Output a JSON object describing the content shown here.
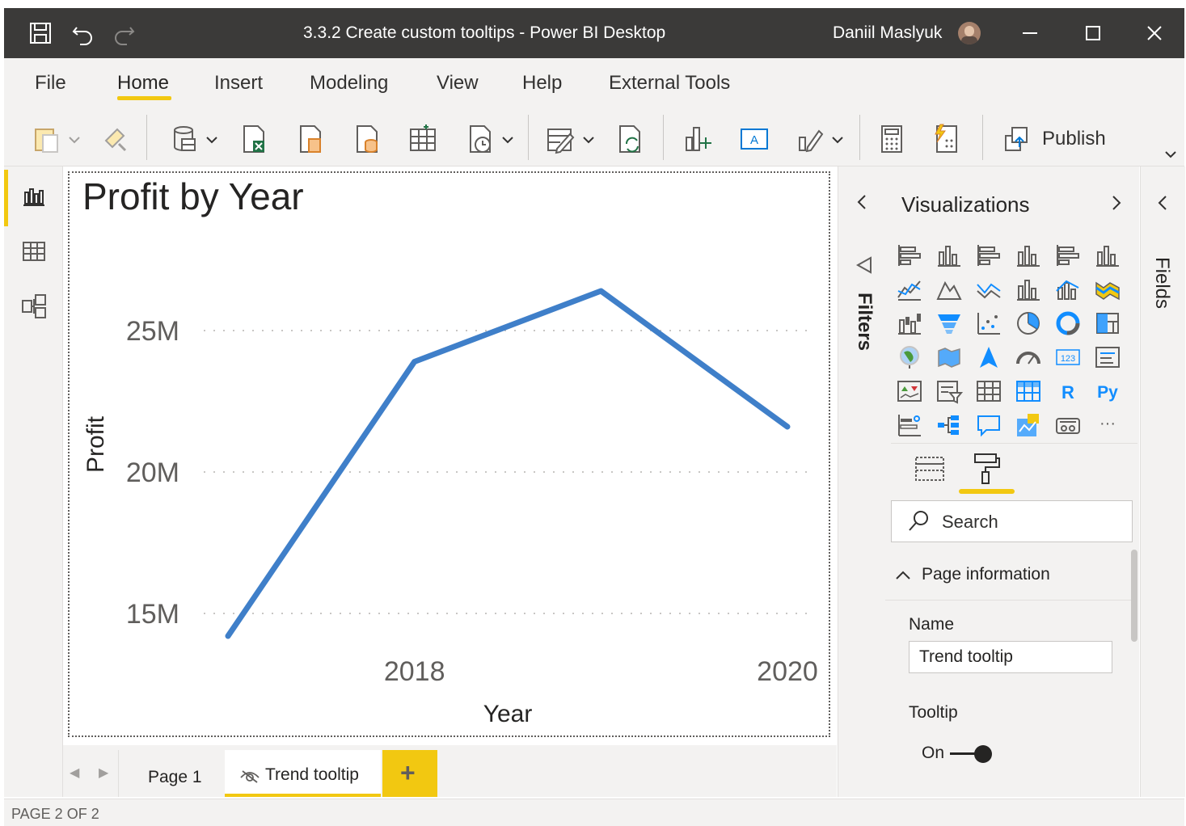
{
  "window": {
    "title": "3.3.2 Create custom tooltips - Power BI Desktop",
    "user": "Daniil Maslyuk"
  },
  "ribbon": {
    "tabs": [
      "File",
      "Home",
      "Insert",
      "Modeling",
      "View",
      "Help",
      "External Tools"
    ],
    "active_tab": "Home",
    "publish_label": "Publish"
  },
  "visual": {
    "title": "Profit by Year"
  },
  "chart_data": {
    "type": "line",
    "title": "Profit by Year",
    "xlabel": "Year",
    "ylabel": "Profit",
    "x": [
      2017,
      2018,
      2019,
      2020
    ],
    "x_tick_labels": [
      "2018",
      "2020"
    ],
    "y_tick_labels": [
      "15M",
      "20M",
      "25M"
    ],
    "y_ticks": [
      15000000,
      20000000,
      25000000
    ],
    "series": [
      {
        "values": [
          14200000,
          23900000,
          26400000,
          21600000
        ],
        "color": "#3f7fc9"
      }
    ],
    "grid": "horizontal dotted",
    "colors": {
      "line": "#3f7fc9"
    }
  },
  "filters_pane": {
    "label": "Filters"
  },
  "visualizations_pane": {
    "title": "Visualizations",
    "search_placeholder": "Search",
    "section_label": "Page information",
    "name_label": "Name",
    "name_value": "Trend tooltip",
    "tooltip_label": "Tooltip",
    "tooltip_state": "On",
    "r_label": "R",
    "py_label": "Py",
    "more_label": "···"
  },
  "fields_pane": {
    "label": "Fields"
  },
  "pages": {
    "tabs": [
      "Page 1",
      "Trend tooltip"
    ],
    "active": "Trend tooltip",
    "add_label": "+"
  },
  "status": {
    "text": "PAGE 2 OF 2"
  },
  "colors": {
    "accent": "#f2c811",
    "titlebar": "#3b3a39",
    "line": "#3f7fc9"
  }
}
